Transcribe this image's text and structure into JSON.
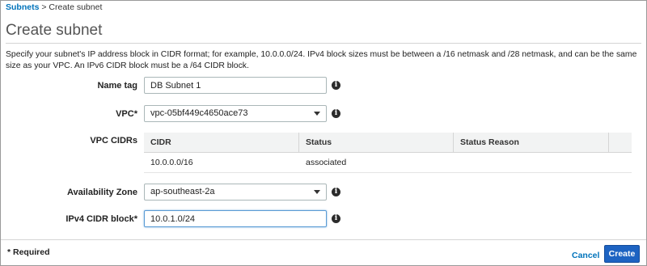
{
  "breadcrumb": {
    "parent": "Subnets",
    "separator": ">",
    "current": "Create subnet"
  },
  "page": {
    "title": "Create subnet",
    "description": "Specify your subnet's IP address block in CIDR format; for example, 10.0.0.0/24. IPv4 block sizes must be between a /16 netmask and /28 netmask, and can be the same size as your VPC. An IPv6 CIDR block must be a /64 CIDR block."
  },
  "form": {
    "name_tag": {
      "label": "Name tag",
      "value": "DB Subnet 1"
    },
    "vpc": {
      "label": "VPC*",
      "value": "vpc-05bf449c4650ace73"
    },
    "vpc_cidrs": {
      "label": "VPC CIDRs",
      "columns": [
        "CIDR",
        "Status",
        "Status Reason"
      ],
      "rows": [
        {
          "cidr": "10.0.0.0/16",
          "status": "associated",
          "reason": ""
        }
      ]
    },
    "availability_zone": {
      "label": "Availability Zone",
      "value": "ap-southeast-2a"
    },
    "ipv4_cidr": {
      "label": "IPv4 CIDR block*",
      "value": "10.0.1.0/24"
    }
  },
  "icons": {
    "info": "i"
  },
  "footer": {
    "required_note": "* Required",
    "cancel_label": "Cancel",
    "create_label": "Create"
  },
  "colors": {
    "link": "#0073bb",
    "primary_button": "#1d63c2",
    "status_ok": "#1d8102"
  }
}
